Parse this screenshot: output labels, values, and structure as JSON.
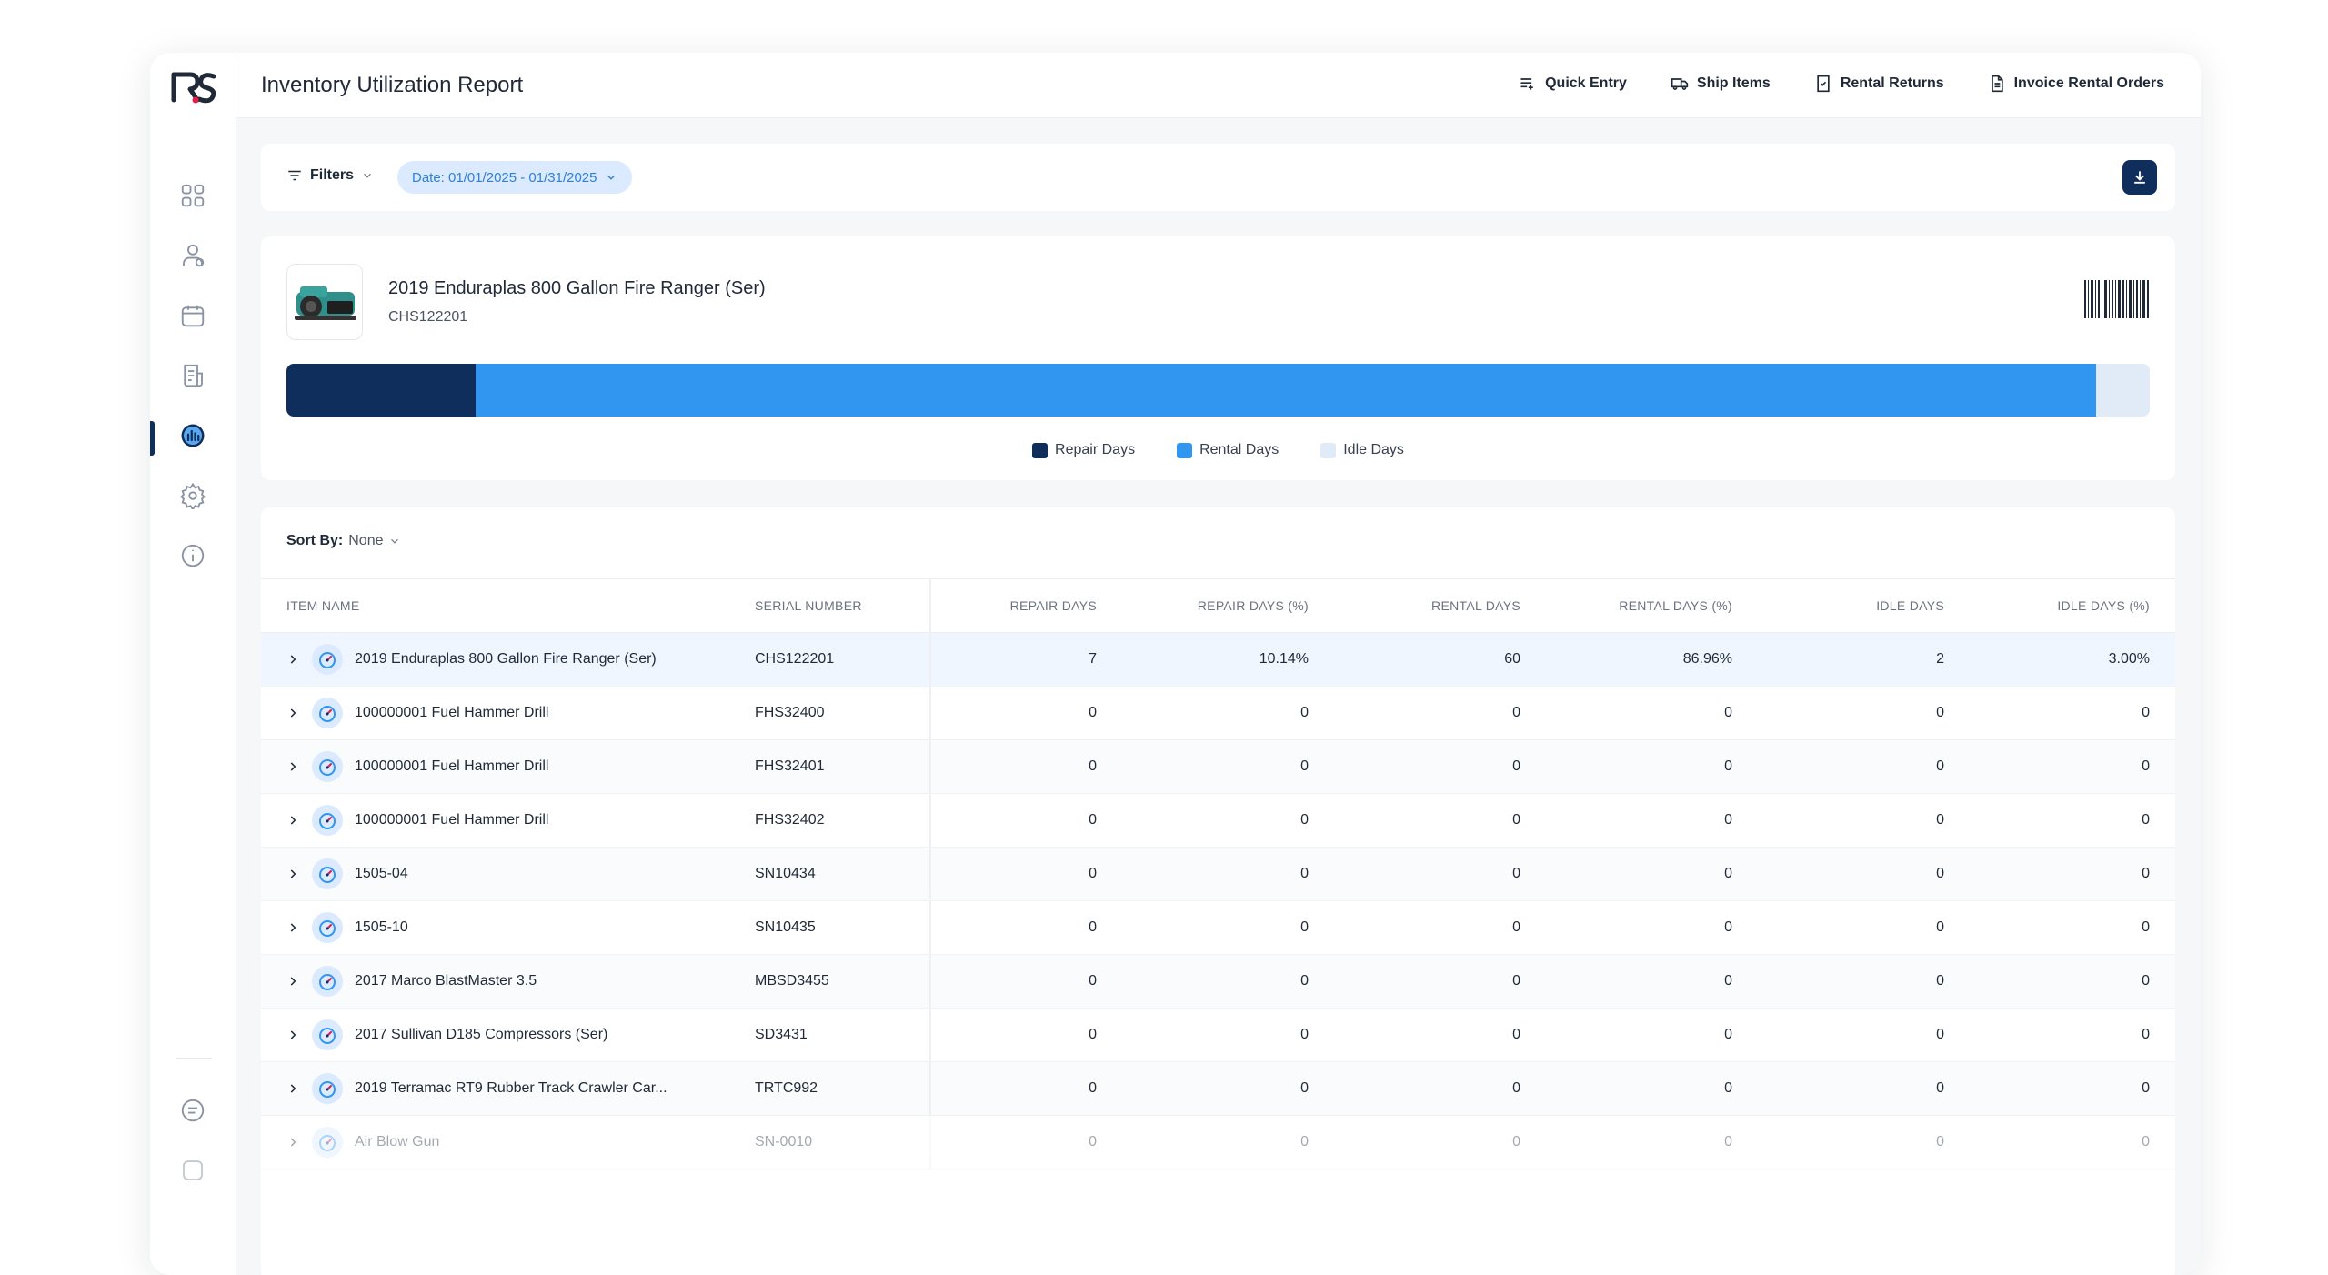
{
  "header": {
    "title": "Inventory Utilization Report",
    "actions": [
      {
        "label": "Quick Entry",
        "icon": "quick-entry-icon"
      },
      {
        "label": "Ship Items",
        "icon": "truck-icon"
      },
      {
        "label": "Rental Returns",
        "icon": "return-document-icon"
      },
      {
        "label": "Invoice Rental Orders",
        "icon": "invoice-icon"
      }
    ]
  },
  "sidebar": {
    "logo": "RS",
    "items": [
      "dashboard-icon",
      "customers-icon",
      "calendar-icon",
      "orders-icon",
      "reports-icon",
      "settings-icon",
      "info-icon"
    ],
    "active": "reports-icon"
  },
  "filters": {
    "label": "Filters",
    "date_chip": "Date: 01/01/2025 - 01/31/2025"
  },
  "summary": {
    "item_name": "2019 Enduraplas 800 Gallon Fire Ranger (Ser)",
    "serial": "CHS122201",
    "utilization": {
      "repair_days": 7,
      "rental_days": 60,
      "idle_days": 2
    },
    "legend": [
      "Repair Days",
      "Rental Days",
      "Idle Days"
    ],
    "colors": {
      "repair": "#0f2e5c",
      "rental": "#3196ef",
      "idle": "#e1ebf8"
    }
  },
  "table": {
    "sort_label": "Sort By:",
    "sort_value": "None",
    "headers": [
      "ITEM NAME",
      "SERIAL NUMBER",
      "REPAIR DAYS",
      "REPAIR DAYS (%)",
      "RENTAL DAYS",
      "RENTAL DAYS (%)",
      "IDLE DAYS",
      "IDLE DAYS (%)"
    ],
    "rows": [
      {
        "name": "2019 Enduraplas 800 Gallon Fire Ranger (Ser)",
        "serial": "CHS122201",
        "repair": "7",
        "repair_pct": "10.14%",
        "rental": "60",
        "rental_pct": "86.96%",
        "idle": "2",
        "idle_pct": "3.00%"
      },
      {
        "name": "100000001 Fuel Hammer Drill",
        "serial": "FHS32400",
        "repair": "0",
        "repair_pct": "0",
        "rental": "0",
        "rental_pct": "0",
        "idle": "0",
        "idle_pct": "0"
      },
      {
        "name": "100000001 Fuel Hammer Drill",
        "serial": "FHS32401",
        "repair": "0",
        "repair_pct": "0",
        "rental": "0",
        "rental_pct": "0",
        "idle": "0",
        "idle_pct": "0"
      },
      {
        "name": "100000001 Fuel Hammer Drill",
        "serial": "FHS32402",
        "repair": "0",
        "repair_pct": "0",
        "rental": "0",
        "rental_pct": "0",
        "idle": "0",
        "idle_pct": "0"
      },
      {
        "name": "1505-04",
        "serial": "SN10434",
        "repair": "0",
        "repair_pct": "0",
        "rental": "0",
        "rental_pct": "0",
        "idle": "0",
        "idle_pct": "0"
      },
      {
        "name": "1505-10",
        "serial": "SN10435",
        "repair": "0",
        "repair_pct": "0",
        "rental": "0",
        "rental_pct": "0",
        "idle": "0",
        "idle_pct": "0"
      },
      {
        "name": "2017 Marco BlastMaster 3.5",
        "serial": "MBSD3455",
        "repair": "0",
        "repair_pct": "0",
        "rental": "0",
        "rental_pct": "0",
        "idle": "0",
        "idle_pct": "0"
      },
      {
        "name": "2017 Sullivan D185 Compressors (Ser)",
        "serial": "SD3431",
        "repair": "0",
        "repair_pct": "0",
        "rental": "0",
        "rental_pct": "0",
        "idle": "0",
        "idle_pct": "0"
      },
      {
        "name": "2019 Terramac RT9 Rubber Track Crawler Car...",
        "serial": "TRTC992",
        "repair": "0",
        "repair_pct": "0",
        "rental": "0",
        "rental_pct": "0",
        "idle": "0",
        "idle_pct": "0"
      },
      {
        "name": "Air Blow Gun",
        "serial": "SN-0010",
        "repair": "0",
        "repair_pct": "0",
        "rental": "0",
        "rental_pct": "0",
        "idle": "0",
        "idle_pct": "0"
      }
    ]
  }
}
